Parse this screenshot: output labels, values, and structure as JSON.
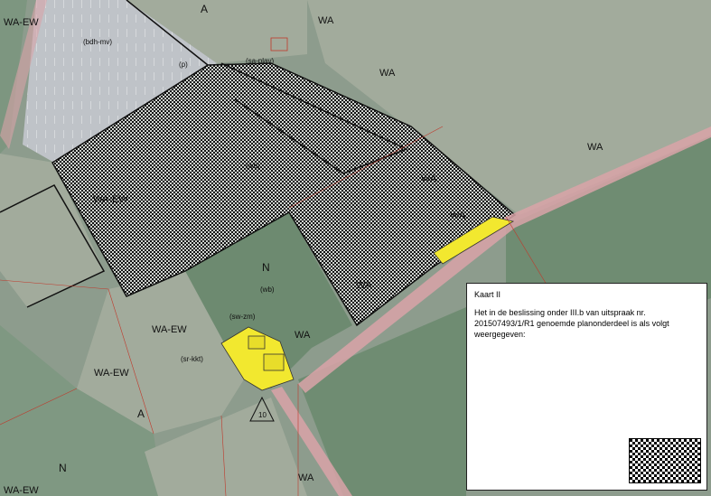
{
  "zones": {
    "a_top": "A",
    "a_bottom": "A",
    "n_center": "N",
    "n_bottom": "N",
    "wa_top": "WA",
    "wa_right_top": "WA",
    "wa_right": "WA",
    "wa_center_right": "WA",
    "wa_hatched_right": "WA",
    "wa_bottom_center": "WA",
    "wa_road": "WA",
    "wa_bottom": "WA",
    "wa_ew_left_top": "WA-EW",
    "wa_ew_mid": "WA-EW",
    "wa_ew_bottom": "WA-EW",
    "wa_bottom_left": "WA-EW",
    "wa_ew_hatched": "WA-EW"
  },
  "functions": {
    "bdh_mv": "(bdh-mv)",
    "p": "(p)",
    "sa_plav": "(sa-plav)",
    "wb_top": "(wb)",
    "wb_center": "(wb)",
    "sw_zm": "(sw-zm)",
    "sr_kkt": "(sr-kkt)",
    "marker_value": "10"
  },
  "legend": {
    "title": "Kaart II",
    "text": "Het in de beslissing onder III.b van uitspraak nr. 201507493/1/R1 genoemde planonderdeel is als volgt weergegeven:"
  },
  "colors": {
    "background": "#8d9c8d",
    "agricultural_light": "#a2ab9c",
    "nature": "#6d8a70",
    "parking": "#bfc3c8",
    "road": "#d9a3a8",
    "yellow_area": "#f2e82f",
    "hatch_dark": "#111111",
    "hatch_light": "#cfd3cf",
    "boundary_red": "#c0392b"
  }
}
